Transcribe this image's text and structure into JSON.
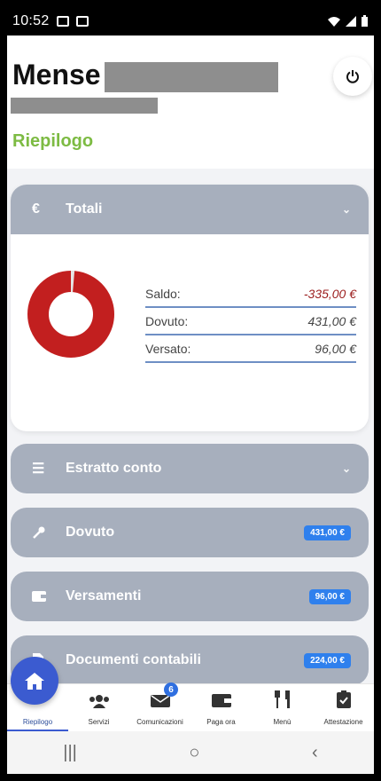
{
  "status": {
    "time": "10:52"
  },
  "header": {
    "title": "Mense",
    "section": "Riepilogo"
  },
  "cards": {
    "totali": {
      "label": "Totali",
      "donut_paid_fraction": 0.0136,
      "colors": {
        "due": "#c21f1f",
        "paid": "#e6e6e6"
      },
      "rows": [
        {
          "label": "Saldo:",
          "value": "-335,00 €"
        },
        {
          "label": "Dovuto:",
          "value": "431,00 €"
        },
        {
          "label": "Versato:",
          "value": "96,00 €"
        }
      ]
    },
    "estratto": {
      "label": "Estratto conto"
    },
    "dovuto": {
      "label": "Dovuto",
      "badge": "431,00 €"
    },
    "versamenti": {
      "label": "Versamenti",
      "badge": "96,00 €"
    },
    "documenti": {
      "label": "Documenti contabili",
      "badge": "224,00 €"
    }
  },
  "nav": {
    "items": [
      {
        "label": "Riepilogo",
        "icon": "home-icon"
      },
      {
        "label": "Servizi",
        "icon": "users-icon"
      },
      {
        "label": "Comunicazioni",
        "icon": "envelope-icon",
        "badge": "6"
      },
      {
        "label": "Paga ora",
        "icon": "wallet-icon"
      },
      {
        "label": "Menù",
        "icon": "cutlery-icon"
      },
      {
        "label": "Attestazione",
        "icon": "clipboard-check-icon"
      }
    ]
  }
}
